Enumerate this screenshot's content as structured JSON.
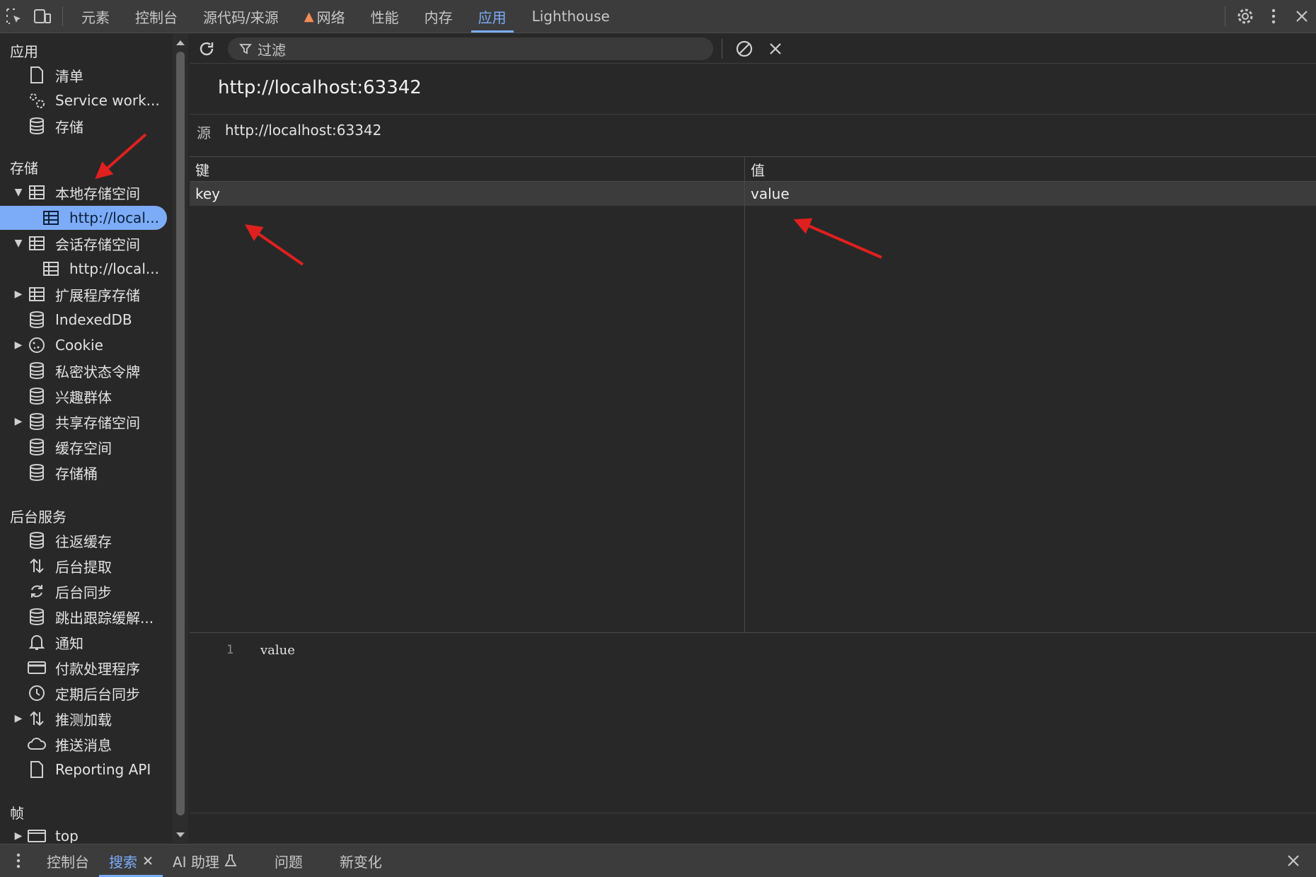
{
  "toolbar": {
    "tabs": [
      "元素",
      "控制台",
      "源代码/来源",
      "网络",
      "性能",
      "内存",
      "应用",
      "Lighthouse"
    ],
    "active_tab": "应用"
  },
  "sidebar": {
    "sections": {
      "app": "应用",
      "storage": "存储",
      "background": "后台服务",
      "frames": "帧"
    },
    "app_items": [
      "清单",
      "Service work...",
      "存储"
    ],
    "storage_items": [
      "本地存储空间",
      "http://local...",
      "会话存储空间",
      "http://local...",
      "扩展程序存储",
      "IndexedDB",
      "Cookie",
      "私密状态令牌",
      "兴趣群体",
      "共享存储空间",
      "缓存空间",
      "存储桶"
    ],
    "background_items": [
      "往返缓存",
      "后台提取",
      "后台同步",
      "跳出跟踪缓解...",
      "通知",
      "付款处理程序",
      "定期后台同步",
      "推测加载",
      "推送消息",
      "Reporting API"
    ],
    "frame_items": [
      "top"
    ]
  },
  "main": {
    "filter_placeholder": "过滤",
    "origin_title": "http://localhost:63342",
    "source_label": "源",
    "source_value": "http://localhost:63342",
    "columns": {
      "key": "键",
      "value": "值"
    },
    "rows": [
      {
        "key": "key",
        "value": "value"
      }
    ],
    "preview": {
      "line_number": "1",
      "text": "value"
    }
  },
  "drawer": {
    "tabs": [
      "控制台",
      "搜索",
      "AI 助理",
      "问题",
      "新变化"
    ],
    "active_tab": "搜索"
  },
  "colors": {
    "accent": "#7cacf8",
    "annotation_arrow": "#e0201f",
    "warning": "#f28b54"
  }
}
